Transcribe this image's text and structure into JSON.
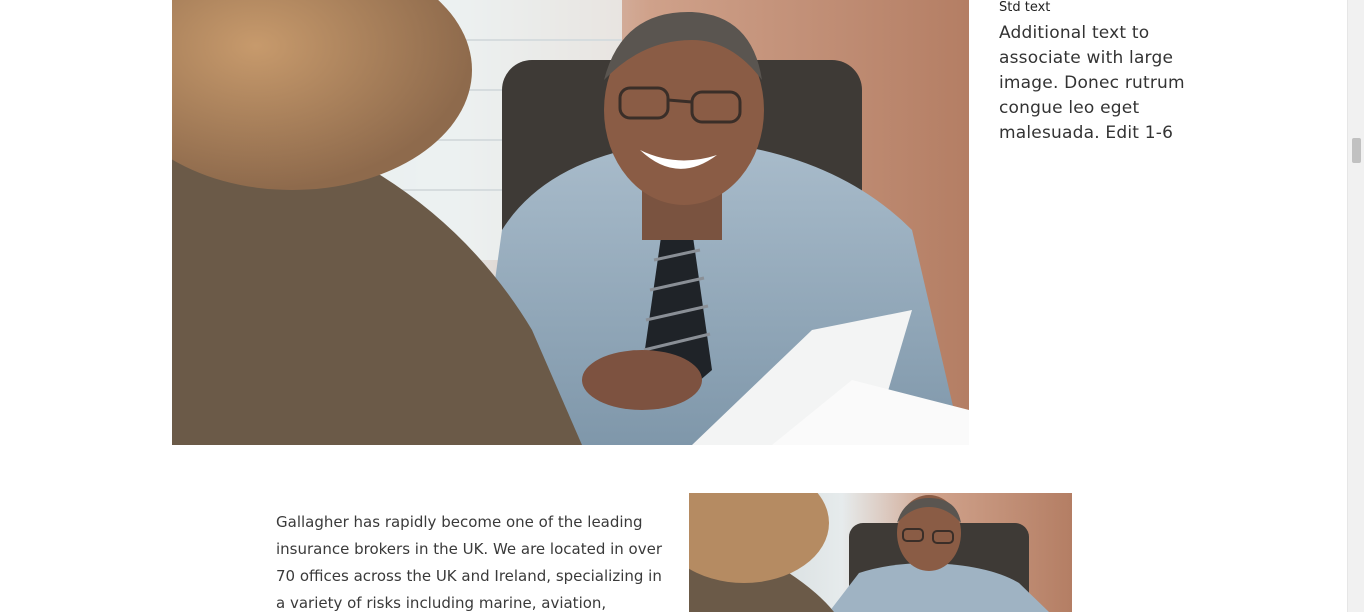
{
  "hero": {
    "image_label": "Large photo: smiling man in blue shirt and striped tie reviewing documents with a woman across a desk"
  },
  "caption": {
    "label": "Std text",
    "text": "Additional text to associate with large image. Donec rutrum congue leo eget malesuada. Edit 1-6"
  },
  "body": {
    "paragraph": "Gallagher has rapidly become one of the leading insurance brokers in the UK. We are located in over 70 offices across the UK and Ireland, specializing in a variety of risks including marine, aviation,"
  },
  "small_image": {
    "image_label": "Smaller version of the same meeting photo"
  },
  "colors": {
    "background": "#ffffff",
    "body_text": "#3a3a3a",
    "caption_text": "#333333"
  }
}
